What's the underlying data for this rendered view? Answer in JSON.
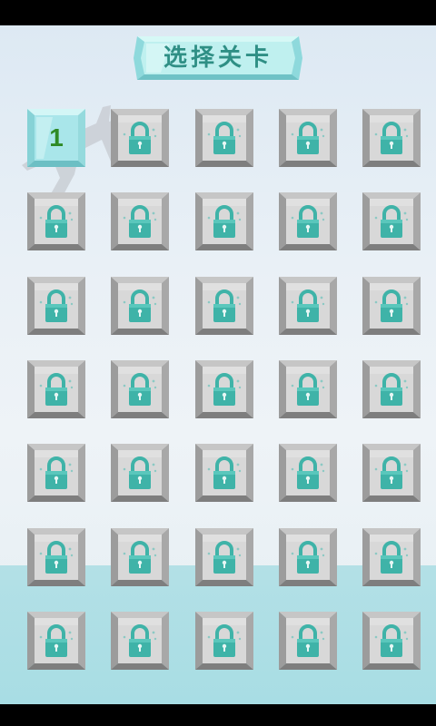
{
  "title": "选择关卡",
  "levels": [
    {
      "label": "1",
      "state": "unlocked"
    },
    {
      "state": "locked"
    },
    {
      "state": "locked"
    },
    {
      "state": "locked"
    },
    {
      "state": "locked"
    },
    {
      "state": "locked"
    },
    {
      "state": "locked"
    },
    {
      "state": "locked"
    },
    {
      "state": "locked"
    },
    {
      "state": "locked"
    },
    {
      "state": "locked"
    },
    {
      "state": "locked"
    },
    {
      "state": "locked"
    },
    {
      "state": "locked"
    },
    {
      "state": "locked"
    },
    {
      "state": "locked"
    },
    {
      "state": "locked"
    },
    {
      "state": "locked"
    },
    {
      "state": "locked"
    },
    {
      "state": "locked"
    },
    {
      "state": "locked"
    },
    {
      "state": "locked"
    },
    {
      "state": "locked"
    },
    {
      "state": "locked"
    },
    {
      "state": "locked"
    },
    {
      "state": "locked"
    },
    {
      "state": "locked"
    },
    {
      "state": "locked"
    },
    {
      "state": "locked"
    },
    {
      "state": "locked"
    },
    {
      "state": "locked"
    },
    {
      "state": "locked"
    },
    {
      "state": "locked"
    },
    {
      "state": "locked"
    },
    {
      "state": "locked"
    }
  ],
  "icons": {
    "locked": "padlock-icon",
    "banner": "crystal-banner"
  },
  "colors": {
    "lock": "#3fb3a8",
    "tile_face": "#d8d8d8",
    "unlocked_face": "#a9e6ea",
    "level_number": "#2f8a26",
    "title_text": "#2f8f85",
    "ocean": "#a8dde4"
  }
}
